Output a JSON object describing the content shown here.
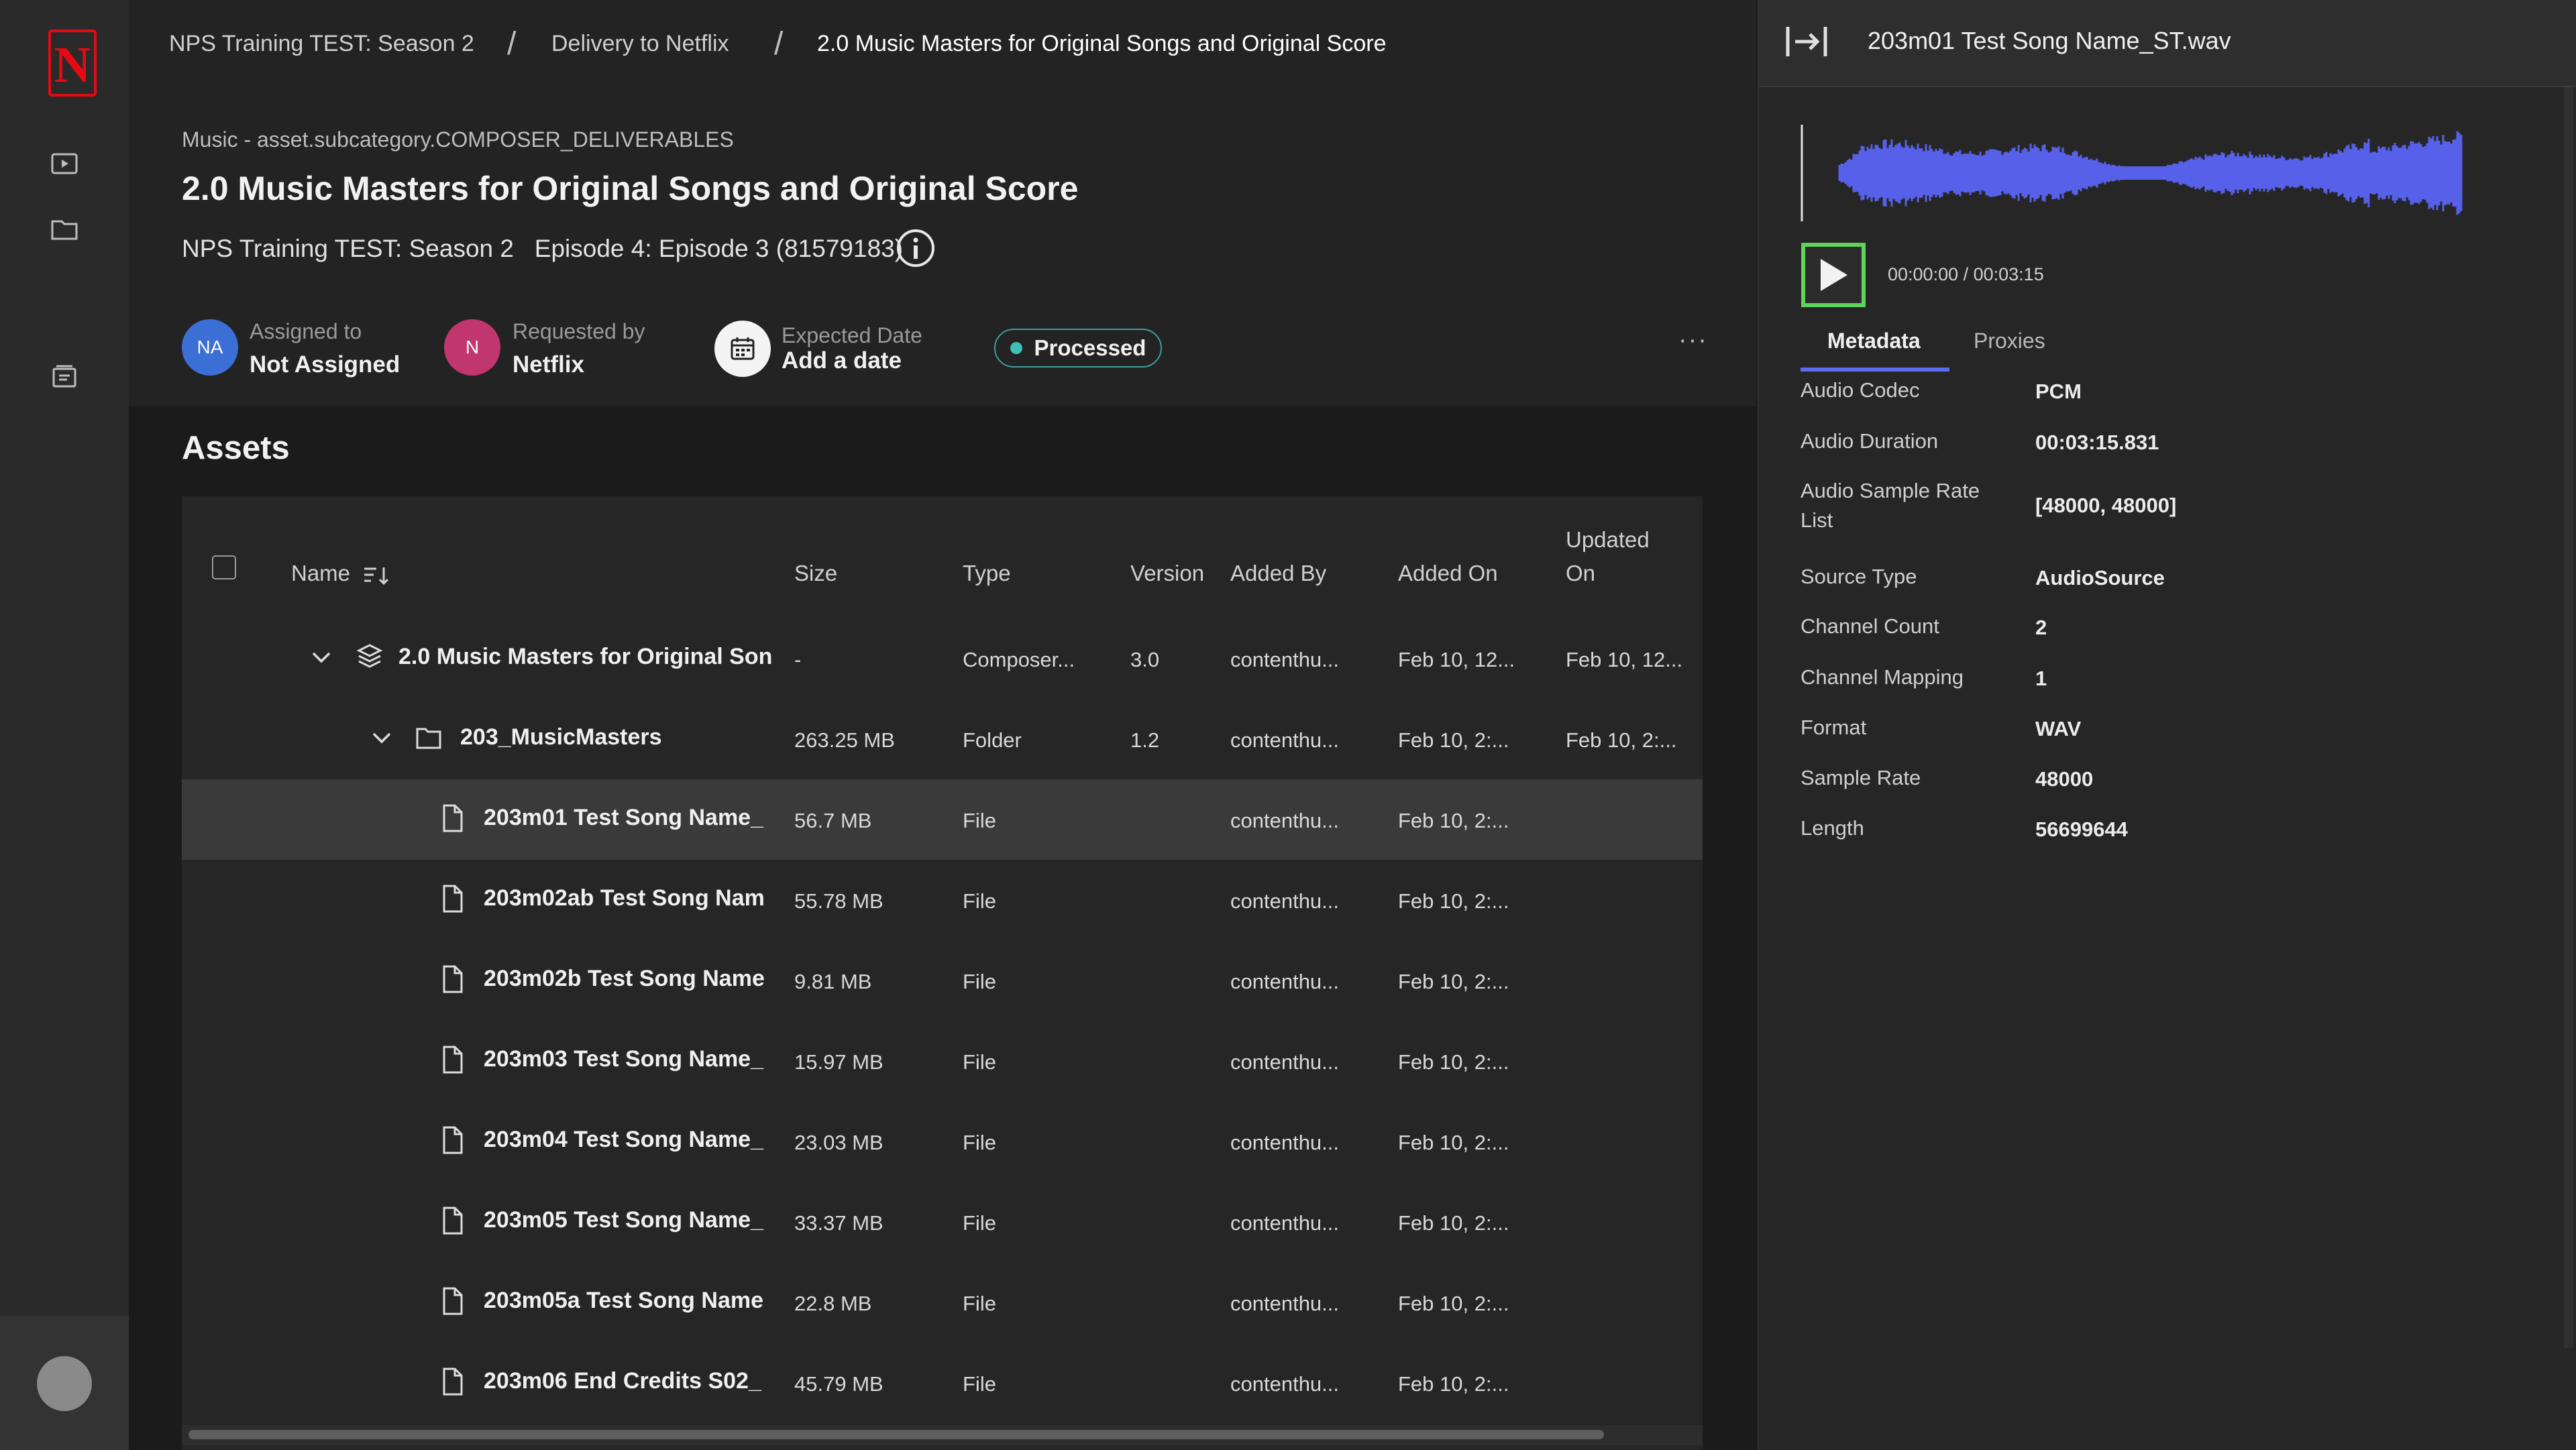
{
  "nav": {
    "logo_letter": "N",
    "items": [
      {
        "icon": "play-box-icon"
      },
      {
        "icon": "folder-icon"
      },
      {
        "icon": "inbox-tray-icon"
      }
    ]
  },
  "breadcrumb": [
    "NPS Training TEST: Season 2",
    "Delivery to Netflix",
    "2.0 Music Masters for Original Songs and Original Score"
  ],
  "breadcrumb_sep": "/",
  "page": {
    "subcategory": "Music - asset.subcategory.COMPOSER_DELIVERABLES",
    "title": "2.0 Music Masters for Original Songs and Original Score",
    "meta_line": "NPS Training TEST: Season 2   Episode 4: Episode 3 (81579183)"
  },
  "assignment": {
    "assigned_label": "Assigned to",
    "assigned_value": "Not Assigned",
    "assigned_initials": "NA",
    "requested_label": "Requested by",
    "requested_value": "Netflix",
    "requested_initials": "N",
    "date_label": "Expected Date",
    "date_value": "Add a date",
    "status": "Processed",
    "more": "···"
  },
  "colors": {
    "assigned_avatar": "#3b6fd6",
    "requested_avatar": "#c2366f",
    "status_dot": "#3ec0b8",
    "accent": "#5b6cf0",
    "waveform": "#5660e8",
    "focus": "#5fd35b"
  },
  "assets": {
    "title": "Assets",
    "columns": [
      "Name",
      "Size",
      "Type",
      "Version",
      "Added By",
      "Added On",
      "Updated",
      "On"
    ],
    "rows": [
      {
        "name": "2.0 Music Masters for Original Son",
        "size": "-",
        "type": "Composer...",
        "version": "3.0",
        "added_by": "contenthu...",
        "added_on": "Feb 10, 12...",
        "updated_on": "Feb 10, 12...",
        "icon": "stack-icon",
        "expand": true,
        "indent": 0
      },
      {
        "name": "203_MusicMasters",
        "size": "263.25 MB",
        "type": "Folder",
        "version": "1.2",
        "added_by": "contenthu...",
        "added_on": "Feb 10, 2:...",
        "updated_on": "Feb 10, 2:...",
        "icon": "folder-icon",
        "expand": true,
        "indent": 1
      },
      {
        "name": "203m01 Test Song Name_",
        "size": "56.7 MB",
        "type": "File",
        "version": "",
        "added_by": "contenthu...",
        "added_on": "Feb 10, 2:...",
        "updated_on": "",
        "icon": "file-icon",
        "expand": false,
        "indent": 2,
        "selected": true
      },
      {
        "name": "203m02ab Test Song Nam",
        "size": "55.78 MB",
        "type": "File",
        "version": "",
        "added_by": "contenthu...",
        "added_on": "Feb 10, 2:...",
        "updated_on": "",
        "icon": "file-icon",
        "expand": false,
        "indent": 2
      },
      {
        "name": "203m02b Test Song Name",
        "size": "9.81 MB",
        "type": "File",
        "version": "",
        "added_by": "contenthu...",
        "added_on": "Feb 10, 2:...",
        "updated_on": "",
        "icon": "file-icon",
        "expand": false,
        "indent": 2
      },
      {
        "name": "203m03 Test Song Name_",
        "size": "15.97 MB",
        "type": "File",
        "version": "",
        "added_by": "contenthu...",
        "added_on": "Feb 10, 2:...",
        "updated_on": "",
        "icon": "file-icon",
        "expand": false,
        "indent": 2
      },
      {
        "name": "203m04 Test Song Name_",
        "size": "23.03 MB",
        "type": "File",
        "version": "",
        "added_by": "contenthu...",
        "added_on": "Feb 10, 2:...",
        "updated_on": "",
        "icon": "file-icon",
        "expand": false,
        "indent": 2
      },
      {
        "name": "203m05 Test Song Name_",
        "size": "33.37 MB",
        "type": "File",
        "version": "",
        "added_by": "contenthu...",
        "added_on": "Feb 10, 2:...",
        "updated_on": "",
        "icon": "file-icon",
        "expand": false,
        "indent": 2
      },
      {
        "name": "203m05a Test Song Name",
        "size": "22.8 MB",
        "type": "File",
        "version": "",
        "added_by": "contenthu...",
        "added_on": "Feb 10, 2:...",
        "updated_on": "",
        "icon": "file-icon",
        "expand": false,
        "indent": 2
      },
      {
        "name": "203m06 End Credits S02_",
        "size": "45.79 MB",
        "type": "File",
        "version": "",
        "added_by": "contenthu...",
        "added_on": "Feb 10, 2:...",
        "updated_on": "",
        "icon": "file-icon",
        "expand": false,
        "indent": 2
      }
    ]
  },
  "panel": {
    "title": "203m01 Test Song Name_ST.wav",
    "time": "00:00:00 / 00:03:15",
    "playback_progress": 0,
    "tabs": [
      "Metadata",
      "Proxies"
    ],
    "active_tab": "Metadata",
    "metadata": [
      {
        "label": "Audio Codec",
        "value": "PCM"
      },
      {
        "label": "Audio Duration",
        "value": "00:03:15.831"
      },
      {
        "label": "Audio Sample Rate List",
        "value": "[48000, 48000]"
      },
      {
        "label": "Source Type",
        "value": "AudioSource"
      },
      {
        "label": "Channel Count",
        "value": "2"
      },
      {
        "label": "Channel Mapping",
        "value": "1"
      },
      {
        "label": "Format",
        "value": "WAV"
      },
      {
        "label": "Sample Rate",
        "value": "48000"
      },
      {
        "label": "Length",
        "value": "56699644"
      }
    ]
  }
}
